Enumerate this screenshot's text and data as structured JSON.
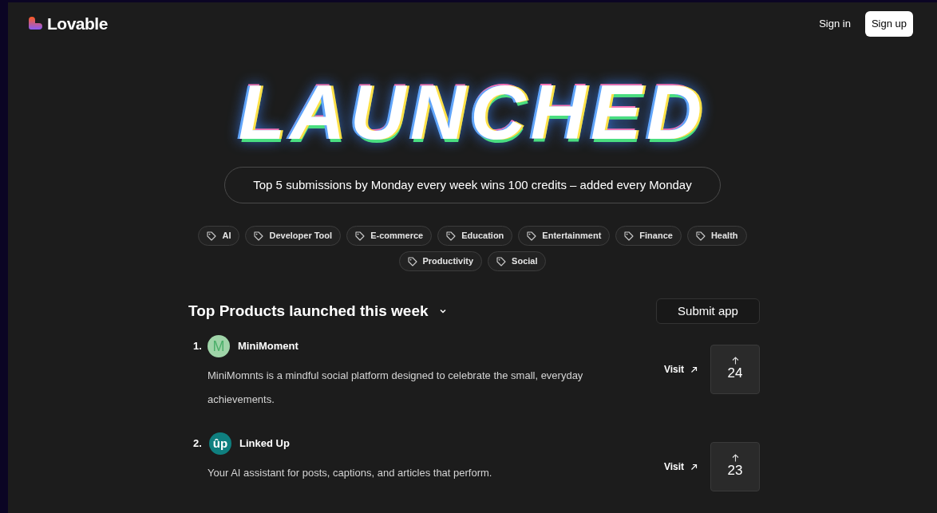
{
  "header": {
    "brand": "Lovable",
    "sign_in": "Sign in",
    "sign_up": "Sign up"
  },
  "hero": {
    "title": "LAUNCHED",
    "banner": "Top 5 submissions by Monday every week wins 100 credits – added every Monday"
  },
  "categories": [
    "AI",
    "Developer Tool",
    "E-commerce",
    "Education",
    "Entertainment",
    "Finance",
    "Health",
    "Productivity",
    "Social"
  ],
  "section": {
    "title": "Top Products launched this week",
    "submit": "Submit app"
  },
  "products": [
    {
      "rank": "1.",
      "name": "MiniMoment",
      "logo": "M",
      "kind": "letter",
      "description": "MiniMomnts is a mindful social platform designed to celebrate the small, everyday achievements.",
      "visit": "Visit",
      "votes": "24"
    },
    {
      "rank": "2.",
      "name": "Linked Up",
      "logo": "ûp",
      "kind": "badge",
      "description": "Your AI assistant for posts, captions, and articles that perform.",
      "visit": "Visit",
      "votes": "23"
    }
  ]
}
